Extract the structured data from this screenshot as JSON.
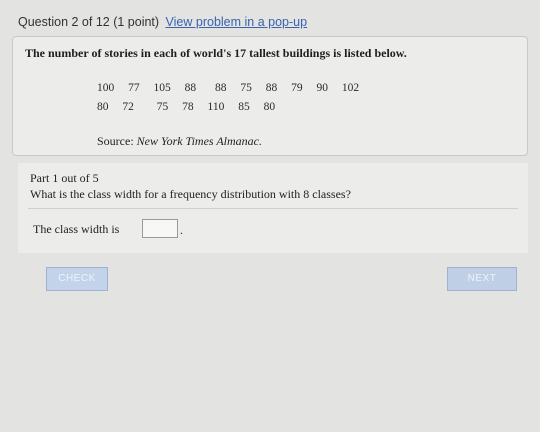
{
  "header": {
    "question_label": "Question 2 of 12 (1 point)",
    "popup_link": "View problem in a pop-up"
  },
  "problem": {
    "statement": "The number of stories in each of world's 17 tallest buildings is listed below.",
    "data_row_1": [
      "100",
      "77",
      "105",
      "88",
      "88",
      "75",
      "88",
      "79",
      "90",
      "102"
    ],
    "data_row_2": [
      "80",
      "72",
      "75",
      "78",
      "110",
      "85",
      "80"
    ],
    "source_prefix": "Source:",
    "source_title": "New York Times Almanac."
  },
  "part": {
    "title": "Part 1 out of 5",
    "question": "What is the class width for a frequency distribution with 8 classes?",
    "answer_label": "The class width is",
    "answer_value": "",
    "answer_suffix": "."
  },
  "buttons": {
    "check_label": "CHECK",
    "next_label": "NEXT"
  }
}
